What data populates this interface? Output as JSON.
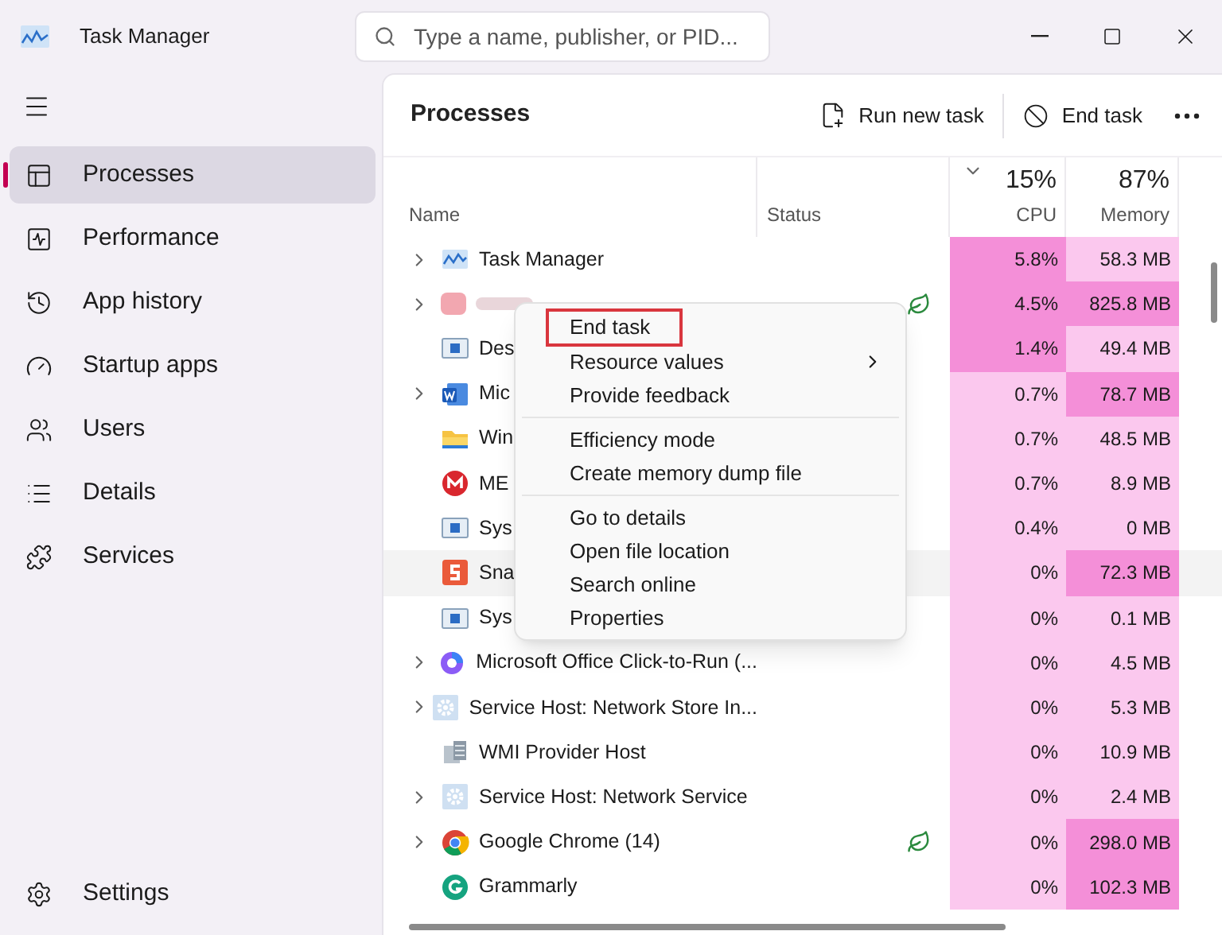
{
  "window": {
    "title": "Task Manager"
  },
  "search": {
    "placeholder": "Type a name, publisher, or PID..."
  },
  "sidebar": {
    "items": [
      {
        "label": "Processes",
        "selected": true
      },
      {
        "label": "Performance",
        "selected": false
      },
      {
        "label": "App history",
        "selected": false
      },
      {
        "label": "Startup apps",
        "selected": false
      },
      {
        "label": "Users",
        "selected": false
      },
      {
        "label": "Details",
        "selected": false
      },
      {
        "label": "Services",
        "selected": false
      }
    ],
    "footer": {
      "label": "Settings"
    }
  },
  "toolbar": {
    "title": "Processes",
    "actions": [
      {
        "label": "Run new task"
      },
      {
        "label": "End task"
      }
    ]
  },
  "table": {
    "columns": [
      {
        "label": "Name"
      },
      {
        "label": "Status"
      },
      {
        "label": "CPU",
        "total": "15%",
        "sorted": true
      },
      {
        "label": "Memory",
        "total": "87%",
        "sorted": false
      }
    ],
    "rows": [
      {
        "name": "Task Manager",
        "kind": "taskmgr",
        "expandable": true,
        "efficiency": false,
        "hovered": false,
        "cpu": "5.8%",
        "cpu_high": true,
        "memory": "58.3 MB",
        "memory_high": false
      },
      {
        "kind": "blurred",
        "expandable": true,
        "efficiency": true,
        "hovered": false,
        "cpu": "4.5%",
        "cpu_high": true,
        "memory": "825.8 MB",
        "memory_high": true
      },
      {
        "name": "Des",
        "kind": "window",
        "expandable": false,
        "efficiency": false,
        "hovered": false,
        "cpu": "1.4%",
        "cpu_high": true,
        "memory": "49.4 MB",
        "memory_high": false
      },
      {
        "name": "Mic",
        "kind": "word",
        "expandable": true,
        "efficiency": false,
        "hovered": false,
        "cpu": "0.7%",
        "cpu_high": false,
        "memory": "78.7 MB",
        "memory_high": true
      },
      {
        "name": "Win",
        "kind": "folder",
        "expandable": false,
        "efficiency": false,
        "hovered": false,
        "cpu": "0.7%",
        "cpu_high": false,
        "memory": "48.5 MB",
        "memory_high": false
      },
      {
        "name": "ME",
        "kind": "mega",
        "expandable": false,
        "efficiency": false,
        "hovered": false,
        "cpu": "0.7%",
        "cpu_high": false,
        "memory": "8.9 MB",
        "memory_high": false
      },
      {
        "name": "Sys",
        "kind": "window",
        "expandable": false,
        "efficiency": false,
        "hovered": false,
        "cpu": "0.4%",
        "cpu_high": false,
        "memory": "0 MB",
        "memory_high": false
      },
      {
        "name": "Sna",
        "kind": "snagit",
        "expandable": false,
        "efficiency": false,
        "hovered": true,
        "cpu": "0%",
        "cpu_high": false,
        "memory": "72.3 MB",
        "memory_high": true
      },
      {
        "name": "Sys",
        "kind": "window",
        "expandable": false,
        "efficiency": false,
        "hovered": false,
        "cpu": "0%",
        "cpu_high": false,
        "memory": "0.1 MB",
        "memory_high": false
      },
      {
        "name": "Microsoft Office Click-to-Run (...",
        "kind": "office",
        "expandable": true,
        "efficiency": false,
        "hovered": false,
        "cpu": "0%",
        "cpu_high": false,
        "memory": "4.5 MB",
        "memory_high": false
      },
      {
        "name": "Service Host: Network Store In...",
        "kind": "gear",
        "expandable": true,
        "efficiency": false,
        "hovered": false,
        "cpu": "0%",
        "cpu_high": false,
        "memory": "5.3 MB",
        "memory_high": false
      },
      {
        "name": "WMI Provider Host",
        "kind": "wmi",
        "expandable": false,
        "efficiency": false,
        "hovered": false,
        "cpu": "0%",
        "cpu_high": false,
        "memory": "10.9 MB",
        "memory_high": false
      },
      {
        "name": "Service Host: Network Service",
        "kind": "gear",
        "expandable": true,
        "efficiency": false,
        "hovered": false,
        "cpu": "0%",
        "cpu_high": false,
        "memory": "2.4 MB",
        "memory_high": false
      },
      {
        "name": "Google Chrome (14)",
        "kind": "chrome",
        "expandable": true,
        "efficiency": true,
        "hovered": false,
        "cpu": "0%",
        "cpu_high": false,
        "memory": "298.0 MB",
        "memory_high": true
      },
      {
        "name": "Grammarly",
        "kind": "grammarly",
        "expandable": false,
        "efficiency": false,
        "hovered": false,
        "cpu": "0%",
        "cpu_high": false,
        "memory": "102.3 MB",
        "memory_high": true
      }
    ]
  },
  "context_menu": {
    "groups": [
      [
        {
          "label": "End task",
          "submenu": false,
          "focused": true
        },
        {
          "label": "Resource values",
          "submenu": true,
          "focused": false
        },
        {
          "label": "Provide feedback",
          "submenu": false,
          "focused": false
        }
      ],
      [
        {
          "label": "Efficiency mode",
          "submenu": false,
          "focused": false
        },
        {
          "label": "Create memory dump file",
          "submenu": false,
          "focused": false
        }
      ],
      [
        {
          "label": "Go to details",
          "submenu": false,
          "focused": false
        },
        {
          "label": "Open file location",
          "submenu": false,
          "focused": false
        },
        {
          "label": "Search online",
          "submenu": false,
          "focused": false
        },
        {
          "label": "Properties",
          "submenu": false,
          "focused": false
        }
      ]
    ]
  }
}
